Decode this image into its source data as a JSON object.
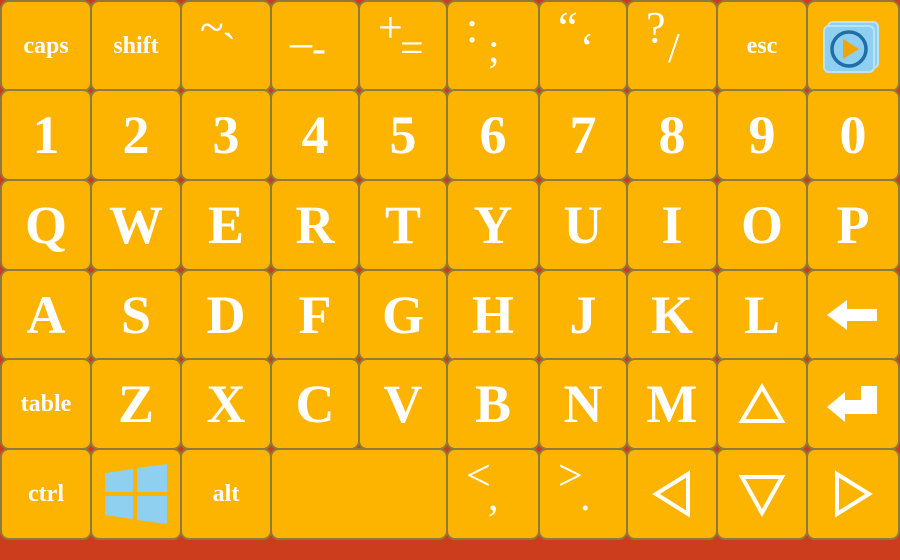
{
  "rows": [
    [
      {
        "id": "caps",
        "label": "caps",
        "kind": "small",
        "name": "caps-key"
      },
      {
        "id": "shift",
        "label": "shift",
        "kind": "small",
        "name": "shift-key"
      },
      {
        "id": "tilde",
        "a": "~",
        "b": "`",
        "kind": "sym",
        "name": "tilde-backtick-key"
      },
      {
        "id": "minus",
        "a": "_",
        "b": "-",
        "kind": "sym",
        "name": "underscore-minus-key"
      },
      {
        "id": "plus",
        "a": "+",
        "b": "=",
        "kind": "sym",
        "name": "plus-equals-key"
      },
      {
        "id": "colon",
        "a": ":",
        "b": ";",
        "kind": "sym",
        "name": "colon-semicolon-key"
      },
      {
        "id": "quote",
        "a": "“",
        "b": "‘",
        "kind": "sym",
        "name": "quote-key"
      },
      {
        "id": "question",
        "a": "?",
        "b": "/",
        "kind": "sym",
        "name": "question-slash-key"
      },
      {
        "id": "esc",
        "label": "esc",
        "kind": "small",
        "name": "esc-key"
      },
      {
        "id": "media",
        "icon": "media-play-icon",
        "kind": "icon",
        "name": "media-play-key"
      }
    ],
    [
      {
        "label": "1",
        "kind": "big",
        "name": "key-1"
      },
      {
        "label": "2",
        "kind": "big",
        "name": "key-2"
      },
      {
        "label": "3",
        "kind": "big",
        "name": "key-3"
      },
      {
        "label": "4",
        "kind": "big",
        "name": "key-4"
      },
      {
        "label": "5",
        "kind": "big",
        "name": "key-5"
      },
      {
        "label": "6",
        "kind": "big",
        "name": "key-6"
      },
      {
        "label": "7",
        "kind": "big",
        "name": "key-7"
      },
      {
        "label": "8",
        "kind": "big",
        "name": "key-8"
      },
      {
        "label": "9",
        "kind": "big",
        "name": "key-9"
      },
      {
        "label": "0",
        "kind": "big",
        "name": "key-0"
      }
    ],
    [
      {
        "label": "Q",
        "kind": "big",
        "name": "key-q"
      },
      {
        "label": "W",
        "kind": "big",
        "name": "key-w"
      },
      {
        "label": "E",
        "kind": "big",
        "name": "key-e"
      },
      {
        "label": "R",
        "kind": "big",
        "name": "key-r"
      },
      {
        "label": "T",
        "kind": "big",
        "name": "key-t"
      },
      {
        "label": "Y",
        "kind": "big",
        "name": "key-y"
      },
      {
        "label": "U",
        "kind": "big",
        "name": "key-u"
      },
      {
        "label": "I",
        "kind": "big",
        "name": "key-i"
      },
      {
        "label": "O",
        "kind": "big",
        "name": "key-o"
      },
      {
        "label": "P",
        "kind": "big",
        "name": "key-p"
      }
    ],
    [
      {
        "label": "A",
        "kind": "big",
        "name": "key-a"
      },
      {
        "label": "S",
        "kind": "big",
        "name": "key-s"
      },
      {
        "label": "D",
        "kind": "big",
        "name": "key-d"
      },
      {
        "label": "F",
        "kind": "big",
        "name": "key-f"
      },
      {
        "label": "G",
        "kind": "big",
        "name": "key-g"
      },
      {
        "label": "H",
        "kind": "big",
        "name": "key-h"
      },
      {
        "label": "J",
        "kind": "big",
        "name": "key-j"
      },
      {
        "label": "K",
        "kind": "big",
        "name": "key-k"
      },
      {
        "label": "L",
        "kind": "big",
        "name": "key-l"
      },
      {
        "icon": "backspace-arrow-icon",
        "kind": "icon",
        "name": "backspace-key"
      }
    ],
    [
      {
        "label": "table",
        "kind": "small",
        "name": "table-key"
      },
      {
        "label": "Z",
        "kind": "big",
        "name": "key-z"
      },
      {
        "label": "X",
        "kind": "big",
        "name": "key-x"
      },
      {
        "label": "C",
        "kind": "big",
        "name": "key-c"
      },
      {
        "label": "V",
        "kind": "big",
        "name": "key-v"
      },
      {
        "label": "B",
        "kind": "big",
        "name": "key-b"
      },
      {
        "label": "N",
        "kind": "big",
        "name": "key-n"
      },
      {
        "label": "M",
        "kind": "big",
        "name": "key-m"
      },
      {
        "icon": "triangle-up-icon",
        "kind": "icon",
        "name": "arrow-up-key"
      },
      {
        "icon": "enter-arrow-icon",
        "kind": "icon",
        "name": "enter-key"
      }
    ],
    [
      {
        "label": "ctrl",
        "kind": "small",
        "name": "ctrl-key"
      },
      {
        "icon": "windows-logo-icon",
        "kind": "icon",
        "name": "windows-key"
      },
      {
        "label": "alt",
        "kind": "small",
        "name": "alt-key"
      },
      {
        "label": "",
        "kind": "space",
        "name": "space-key"
      },
      {
        "id": "lt",
        "a": "<",
        "b": ",",
        "kind": "sym",
        "name": "less-comma-key"
      },
      {
        "id": "gt",
        "a": ">",
        "b": ".",
        "kind": "sym",
        "name": "greater-period-key"
      },
      {
        "icon": "triangle-left-icon",
        "kind": "icon",
        "name": "arrow-left-key"
      },
      {
        "icon": "triangle-down-icon",
        "kind": "icon",
        "name": "arrow-down-key"
      },
      {
        "icon": "triangle-right-icon",
        "kind": "icon",
        "name": "arrow-right-key"
      }
    ]
  ],
  "colors": {
    "key": "#fdb400",
    "border": "#8f7a3d",
    "text": "#ffffff",
    "accent": "#8fd0f0"
  }
}
